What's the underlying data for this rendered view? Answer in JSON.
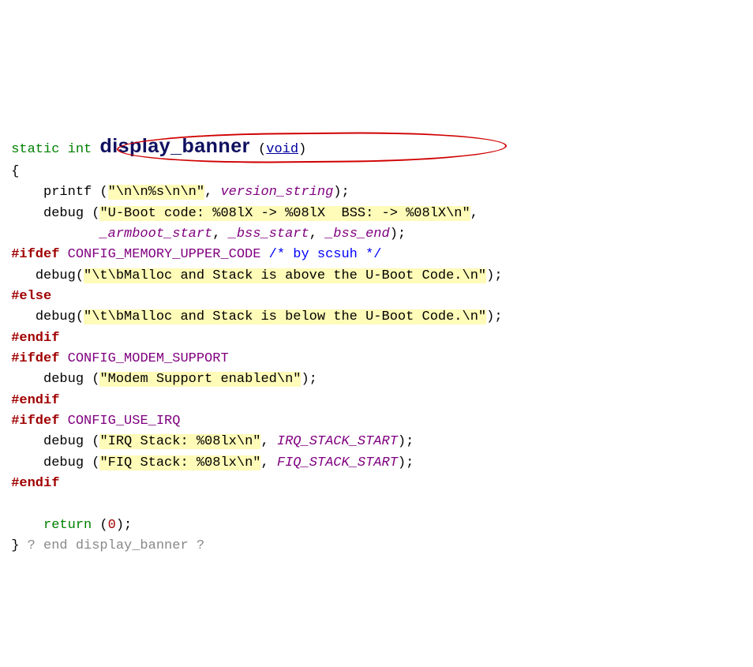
{
  "annotation": {
    "circled_region": "printf (\"\\n\\n%s\\n\\n\", version_string);"
  },
  "code": {
    "l1": {
      "static": "static",
      "int": "int",
      "funcname": "display_banner",
      "void": "void"
    },
    "l2": {
      "brace": "{"
    },
    "l3": {
      "fn": "printf",
      "str": "\"\\n\\n%s\\n\\n\"",
      "arg": "version_string"
    },
    "l4": {
      "fn": "debug",
      "str": "\"U-Boot code: %08lX -> %08lX  BSS: -> %08lX\\n\""
    },
    "l5": {
      "a1": "_armboot_start",
      "a2": "_bss_start",
      "a3": "_bss_end"
    },
    "l6": {
      "pp": "#ifdef",
      "id": "CONFIG_MEMORY_UPPER_CODE",
      "cmt": " /* by scsuh */"
    },
    "l7": {
      "fn": "debug",
      "str": "\"\\t\\bMalloc and Stack is above the U-Boot Code.\\n\""
    },
    "l8": {
      "pp": "#else"
    },
    "l9": {
      "fn": "debug",
      "str": "\"\\t\\bMalloc and Stack is below the U-Boot Code.\\n\""
    },
    "l10": {
      "pp": "#endif"
    },
    "l11": {
      "pp": "#ifdef",
      "id": "CONFIG_MODEM_SUPPORT"
    },
    "l12": {
      "fn": "debug",
      "str": "\"Modem Support enabled\\n\""
    },
    "l13": {
      "pp": "#endif"
    },
    "l14": {
      "pp": "#ifdef",
      "id": "CONFIG_USE_IRQ"
    },
    "l15": {
      "fn": "debug",
      "str": "\"IRQ Stack: %08lx\\n\"",
      "arg": "IRQ_STACK_START"
    },
    "l16": {
      "fn": "debug",
      "str": "\"FIQ Stack: %08lx\\n\"",
      "arg": "FIQ_STACK_START"
    },
    "l17": {
      "pp": "#endif"
    },
    "l19": {
      "ret": "return",
      "val": "0"
    },
    "l20": {
      "brace": "}",
      "fold": " ? end display_banner ?"
    }
  }
}
